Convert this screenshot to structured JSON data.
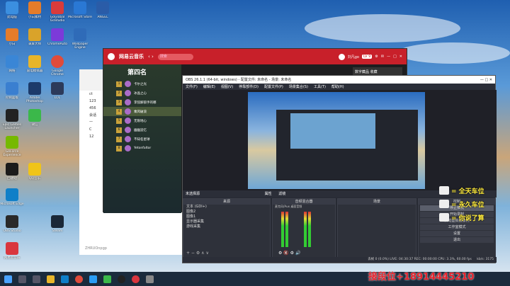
{
  "desktop_icons": [
    {
      "label": "此电脑",
      "color": "#3b8fe0"
    },
    {
      "label": "小白素材",
      "color": "#e57c2a"
    },
    {
      "label": "GoGlobal GoStudio",
      "color": "#d93b3b"
    },
    {
      "label": "Microsoft Store",
      "color": "#2a78d4"
    },
    {
      "label": "ANGEL",
      "color": "#2a5ca8"
    },
    {
      "label": "小白",
      "color": "#4aa3df"
    },
    {
      "label": "录屏大师",
      "color": "#d9a32a"
    },
    {
      "label": "ChromeAuto",
      "color": "#7c3ad9"
    },
    {
      "label": "Wallpaper Engine",
      "color": "#2f6bb8"
    },
    {
      "label": "Adobe Photoshop",
      "color": "#1c3a6a"
    },
    {
      "label": "网络",
      "color": "#3a86d6"
    },
    {
      "label": "雷电模拟器",
      "color": "#e8b52a"
    },
    {
      "label": "Google Chrome",
      "color": "#e04b3b"
    },
    {
      "label": "LOL",
      "color": "#2c3a5a"
    },
    {
      "label": "控制面板",
      "color": "#3a7fd0"
    },
    {
      "label": "Epic Games Launcher",
      "color": "#222222"
    },
    {
      "label": "GeForce Experience",
      "color": "#76b900"
    },
    {
      "label": "Microsoft Edge",
      "color": "#0f7fc8"
    },
    {
      "label": "OBS Studio",
      "color": "#2a2a2a"
    },
    {
      "label": "Steam",
      "color": "#1b2838"
    },
    {
      "label": "回收站",
      "color": "#7aa9d8"
    },
    {
      "label": "微信",
      "color": "#3bb84a"
    },
    {
      "label": "QQ音乐",
      "color": "#f0c419"
    },
    {
      "label": "网易云音乐",
      "color": "#d9363e"
    }
  ],
  "netease": {
    "app_title": "网易云音乐",
    "search_placeholder": "搜索",
    "username": "刘凡go",
    "level_badge": "LV 9",
    "rank_title": "第四名",
    "rank_rows": [
      {
        "num": "1",
        "name": "卡尔之光"
      },
      {
        "num": "2",
        "name": "冰晶之心"
      },
      {
        "num": "3",
        "name": "李弦解锁手的哪"
      },
      {
        "num": "4",
        "name": "乘风破浪"
      },
      {
        "num": "5",
        "name": "无限地心"
      },
      {
        "num": "6",
        "name": "幽幽追忆"
      },
      {
        "num": "7",
        "name": "不知名星球"
      },
      {
        "num": "8",
        "name": "Yetonfaltor"
      }
    ],
    "side_card_label": "数字藏品 收藏"
  },
  "chat": {
    "items": [
      "ct",
      "123",
      "456",
      "会话",
      "一",
      "C",
      "12"
    ],
    "input_label": "ZHRUOnpgp"
  },
  "obs": {
    "window_title": "OBS 26.1.1 (64-bit, windows) - 配置文件: 未命名 - 场景: 未命名",
    "menu": [
      "文件(F)",
      "编辑(E)",
      "视图(V)",
      "停靠部件(D)",
      "配置文件(P)",
      "场景集合(S)",
      "工具(T)",
      "帮助(H)"
    ],
    "no_source_label": "未选择源",
    "props_label": "属性",
    "filters_label": "滤镜",
    "panels": {
      "sources": "来源",
      "mixer": "音频混合器",
      "scenes": "场景",
      "controls": "控制"
    },
    "sources": [
      "文本 (GDI+)",
      "图像2",
      "图像1",
      "显示器采集",
      "游戏采集"
    ],
    "mixer_channels": [
      "麦克风/Aux",
      "桌面音频"
    ],
    "controls": [
      "停止推流",
      "开始录制",
      "启动虚拟摄像机",
      "工作室模式",
      "设置",
      "退出"
    ],
    "status": "丢帧 0 (0.0%)  LIVE: 04:30:37  REC: 00:00:00  CPU: 3.3%, 60.00 fps",
    "bitrate": "kb/s: 3175"
  },
  "overlay": {
    "lines": [
      "= 全天车位",
      "= 永久车位",
      "= 你说了算"
    ],
    "watermark": "接段位+18914445210"
  },
  "taskbar": {
    "icons": [
      "start",
      "search",
      "task-view",
      "explorer",
      "edge",
      "chrome",
      "qq",
      "wechat",
      "obs",
      "netease",
      "media"
    ]
  }
}
